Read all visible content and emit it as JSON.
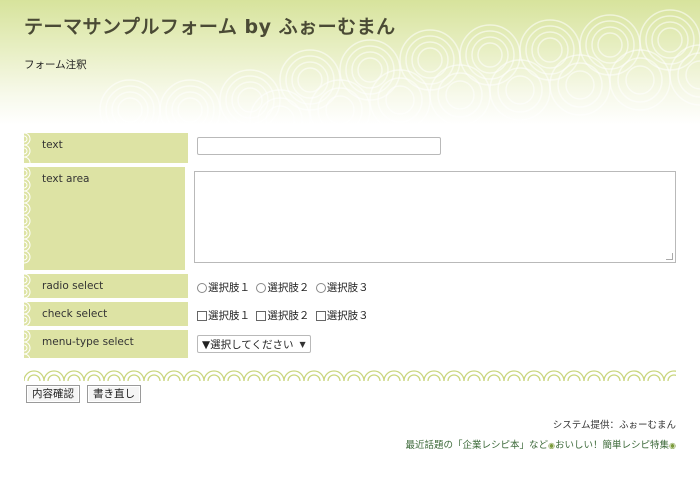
{
  "header": {
    "title": "テーマサンプルフォーム by ふぉーむまん",
    "note": "フォーム注釈"
  },
  "form": {
    "rows": [
      {
        "label": "text",
        "type": "text-input",
        "value": ""
      },
      {
        "label": "text area",
        "type": "textarea",
        "value": ""
      },
      {
        "label": "radio select",
        "type": "radio",
        "options": [
          "選択肢１",
          "選択肢２",
          "選択肢３"
        ]
      },
      {
        "label": "check select",
        "type": "checkbox",
        "options": [
          "選択肢１",
          "選択肢２",
          "選択肢３"
        ]
      },
      {
        "label": "menu-type select",
        "type": "select",
        "selected": "▼選択してください"
      }
    ]
  },
  "buttons": {
    "confirm_label": "内容確認",
    "reset_label": "書き直し"
  },
  "footer": {
    "credit": "システム提供：ふぉーむまん",
    "promo_text": "最近話題の「企業レシピ本」など",
    "promo_dot": "◉",
    "promo_link": "おいしい！簡単レシピ特集"
  },
  "colors": {
    "label_bg": "#dde3a4",
    "header_green": "#d7e39c",
    "wave_green": "#c9d67e"
  }
}
